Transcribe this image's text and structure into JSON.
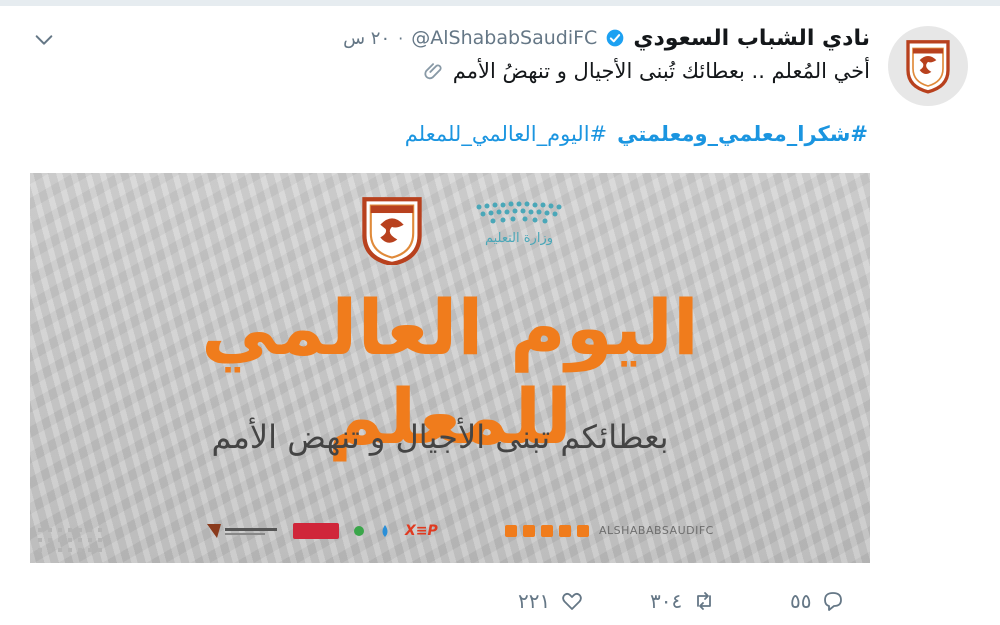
{
  "tweet": {
    "display_name": "نادي الشباب السعودي",
    "verified": true,
    "handle": "@AlShababSaudiFC",
    "separator": "·",
    "time": "٢٠ س",
    "text": "أخي المُعلم .. بعطائك تُبنى الأجيال و تنهضُ الأمم",
    "hashtags": [
      {
        "label": "#اليوم_العالمي_للمعلم",
        "bold": false
      },
      {
        "label": "#شكرا_معلمي_ومعلمتي",
        "bold": true
      }
    ]
  },
  "media": {
    "ministry_label": "وزارة التعليم",
    "headline": "اليوم العالمي للمعلم",
    "subline": "بعطائكم تبنى الأجيال و تنهض الأمم",
    "social_handle": "ALSHABABSAUDIFC",
    "sponsor_text": "X≡P"
  },
  "actions": {
    "reply_count": "٥٥",
    "retweet_count": "٣٠٤",
    "like_count": "٢٢١"
  },
  "colors": {
    "link": "#1b95e0",
    "muted": "#657786",
    "headline_orange": "#f07c1c",
    "verified_blue": "#1da1f2"
  },
  "icons": [
    "chevron-down-icon",
    "verified-badge-icon",
    "paperclip-icon",
    "reply-icon",
    "retweet-icon",
    "like-icon",
    "club-crest-logo",
    "ministry-logo"
  ]
}
